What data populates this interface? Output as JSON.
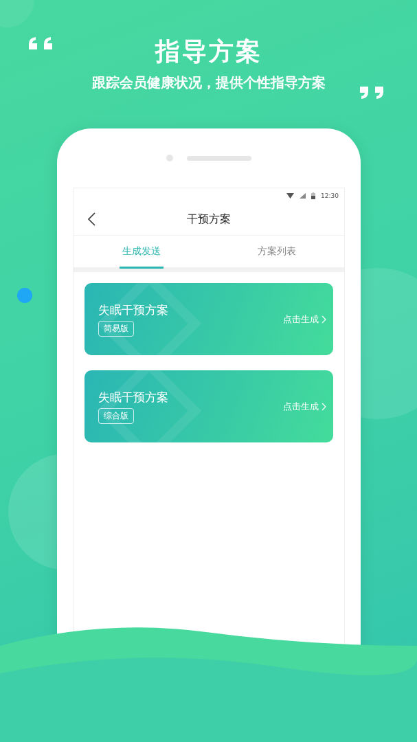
{
  "header": {
    "title": "指导方案",
    "subtitle": "跟踪会员健康状况，提供个性指导方案"
  },
  "status_bar": {
    "time": "12:30"
  },
  "nav": {
    "title": "干预方案"
  },
  "tabs": [
    {
      "label": "生成发送",
      "selected": true
    },
    {
      "label": "方案列表",
      "selected": false
    }
  ],
  "plans": [
    {
      "title": "失眠干预方案",
      "tag": "简易版",
      "action": "点击生成"
    },
    {
      "title": "失眠干预方案",
      "tag": "综合版",
      "action": "点击生成"
    }
  ]
}
